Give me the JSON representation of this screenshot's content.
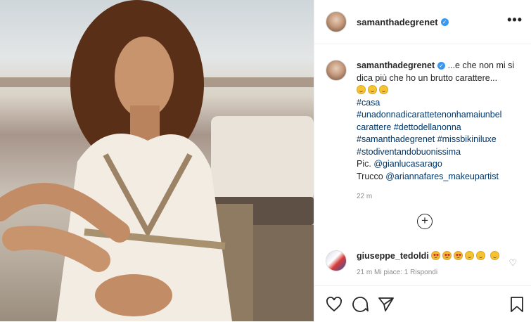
{
  "post": {
    "username": "samanthadegrenet",
    "more_label": "•••"
  },
  "caption": {
    "username": "samanthadegrenet",
    "text": "...e che non mi si dica più che ho un brutto carattere...",
    "emoji_count": 3,
    "hashtags": [
      "#casa",
      "#unadonnadicarattetenonhamaiunbel carattere",
      "#dettodellanonna",
      "#samanthadegrenet",
      "#missbikiniluxe",
      "#stodiventandobuonissima"
    ],
    "pic_label": "Pic.",
    "pic_user": "@gianlucasarago",
    "trucco_label": "Trucco",
    "trucco_user": "@ariannafares_makeupartist",
    "time": "22 m"
  },
  "comment": {
    "username": "giuseppe_tedoldi",
    "meta": "21 m    Mi piace: 1    Rispondi"
  },
  "colors": {
    "verified": "#3897f0",
    "link": "#00376b",
    "muted": "#8e8e8e"
  },
  "icons": [
    "heart-icon",
    "comment-icon",
    "share-icon",
    "bookmark-icon",
    "add-comment-icon"
  ]
}
